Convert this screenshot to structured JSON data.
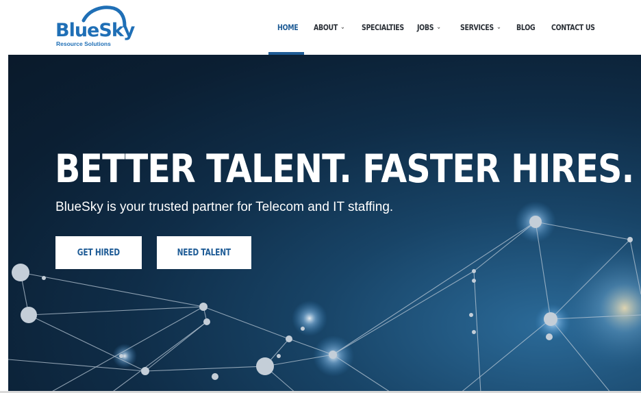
{
  "brand": {
    "name": "BlueSky",
    "tagline": "Resource Solutions",
    "color": "#1f6fb6"
  },
  "nav": {
    "items": [
      {
        "label": "HOME",
        "active": true,
        "dropdown": false
      },
      {
        "label": "ABOUT",
        "active": false,
        "dropdown": true
      },
      {
        "label": "SPECIALTIES",
        "active": false,
        "dropdown": false
      },
      {
        "label": "JOBS",
        "active": false,
        "dropdown": true
      },
      {
        "label": "SERVICES",
        "active": false,
        "dropdown": true
      },
      {
        "label": "BLOG",
        "active": false,
        "dropdown": false
      },
      {
        "label": "CONTACT US",
        "active": false,
        "dropdown": false
      }
    ],
    "caret": "⌄",
    "active_color": "#1f5c96"
  },
  "hero": {
    "headline": "BETTER TALENT. FASTER HIRES.",
    "subheadline": "BlueSky is your trusted partner for Telecom and IT staffing.",
    "buttons": [
      {
        "label": "GET HIRED"
      },
      {
        "label": "NEED TALENT"
      }
    ]
  }
}
